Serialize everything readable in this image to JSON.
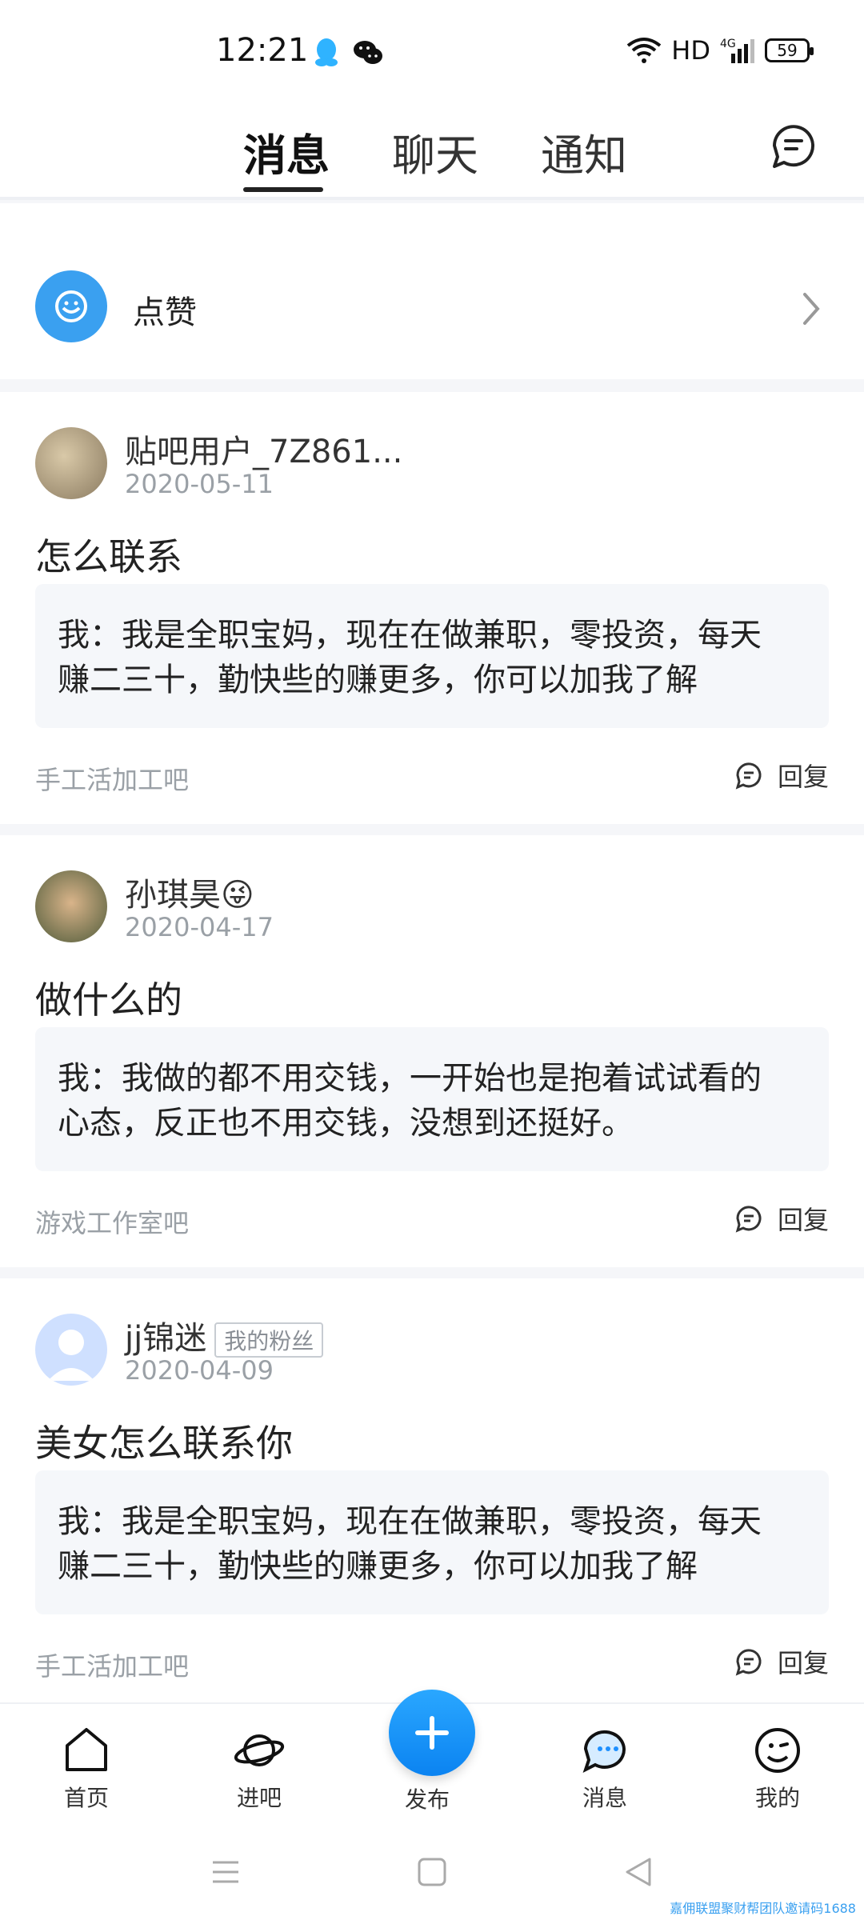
{
  "status_bar": {
    "time": "12:21",
    "network": "HD",
    "signal": "4G",
    "battery": "59"
  },
  "tabs": {
    "items": [
      "消息",
      "聊天",
      "通知"
    ],
    "active_index": 0
  },
  "like_row": {
    "label": "点赞"
  },
  "messages": [
    {
      "user": "贴吧用户_7Z861...",
      "date": "2020-05-11",
      "title": "怎么联系",
      "quote_line1": "我：我是全职宝妈，现在在做兼职，零投资，每天",
      "quote_line2": "赚二三十，勤快些的赚更多，你可以加我了解",
      "forum": "手工活加工吧",
      "reply_label": "回复"
    },
    {
      "user": "孙琪昊😜",
      "date": "2020-04-17",
      "title": "做什么的",
      "quote_line1": "我：我做的都不用交钱，一开始也是抱着试试看的",
      "quote_line2": "心态，反正也不用交钱，没想到还挺好。",
      "forum": "游戏工作室吧",
      "reply_label": "回复"
    },
    {
      "user": "jj锦迷",
      "badge": "我的粉丝",
      "date": "2020-04-09",
      "title": "美女怎么联系你",
      "quote_line1": "我：我是全职宝妈，现在在做兼职，零投资，每天",
      "quote_line2": "赚二三十，勤快些的赚更多，你可以加我了解",
      "forum": "手工活加工吧",
      "reply_label": "回复"
    }
  ],
  "bottom_nav": {
    "home": "首页",
    "enter_bar": "进吧",
    "publish": "发布",
    "messages": "消息",
    "mine": "我的"
  },
  "watermark": "嘉佣联盟聚财帮团队邀请码1688",
  "colors": {
    "accent": "#1E90FF",
    "muted": "#9AA0A6"
  }
}
